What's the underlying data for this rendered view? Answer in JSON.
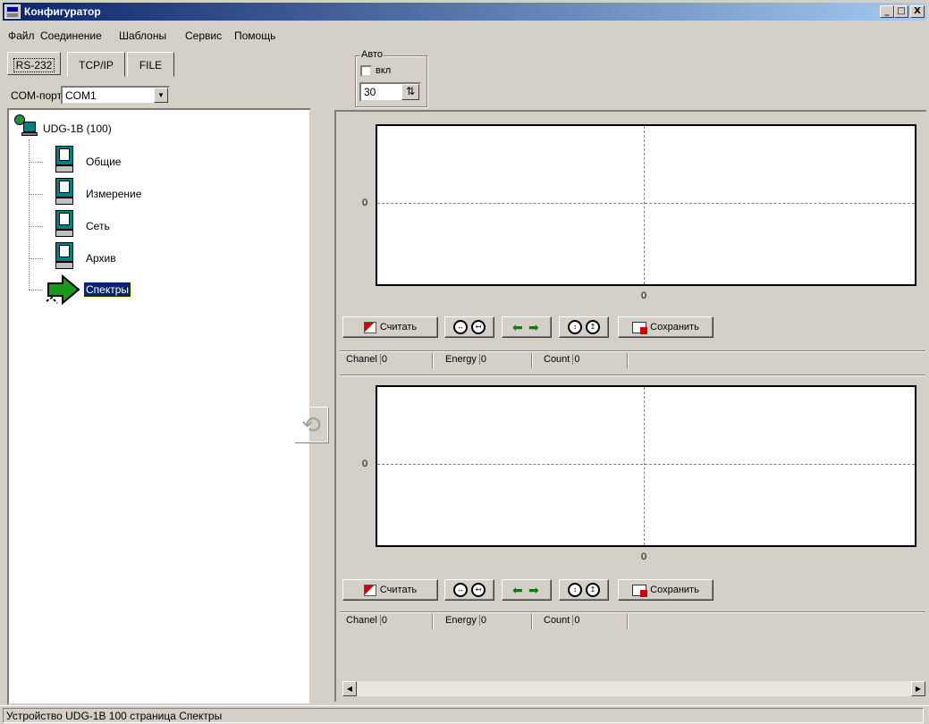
{
  "window": {
    "title": "Конфигуратор",
    "minimize": "_",
    "maximize": "□",
    "close": "X"
  },
  "menu": [
    "Файл",
    "Соединение",
    "Шаблоны",
    "Сервис",
    "Помощь"
  ],
  "tabs": [
    {
      "label": "RS-232",
      "active": true
    },
    {
      "label": "TCP/IP",
      "active": false
    },
    {
      "label": "FILE",
      "active": false
    }
  ],
  "com_port": {
    "label": "COM-порт:",
    "value": "COM1"
  },
  "auto": {
    "title": "Авто",
    "checkbox_label": "вкл",
    "checked": false,
    "interval": "30"
  },
  "tree": {
    "root": "UDG-1B  (100)",
    "children": [
      "Общие",
      "Измерение",
      "Сеть",
      "Архив",
      "Спектры"
    ],
    "selected": "Спектры"
  },
  "charts": [
    {
      "y_tick": "0",
      "x_tick": "0",
      "toolbar": {
        "read": "Считать",
        "save": "Сохранить"
      },
      "status": {
        "chanel_label": "Chanel",
        "chanel": "0",
        "energy_label": "Energy",
        "energy": "0",
        "count_label": "Count",
        "count": "0"
      }
    },
    {
      "y_tick": "0",
      "x_tick": "0",
      "toolbar": {
        "read": "Считать",
        "save": "Сохранить"
      },
      "status": {
        "chanel_label": "Chanel",
        "chanel": "0",
        "energy_label": "Energy",
        "energy": "0",
        "count_label": "Count",
        "count": "0"
      }
    }
  ],
  "statusbar": "Устройство UDG-1B 100  страница Спектры",
  "icons": {
    "spin": "spin-updown-icon",
    "nav_left": "arrow-left-icon",
    "nav_right": "arrow-right-icon"
  }
}
